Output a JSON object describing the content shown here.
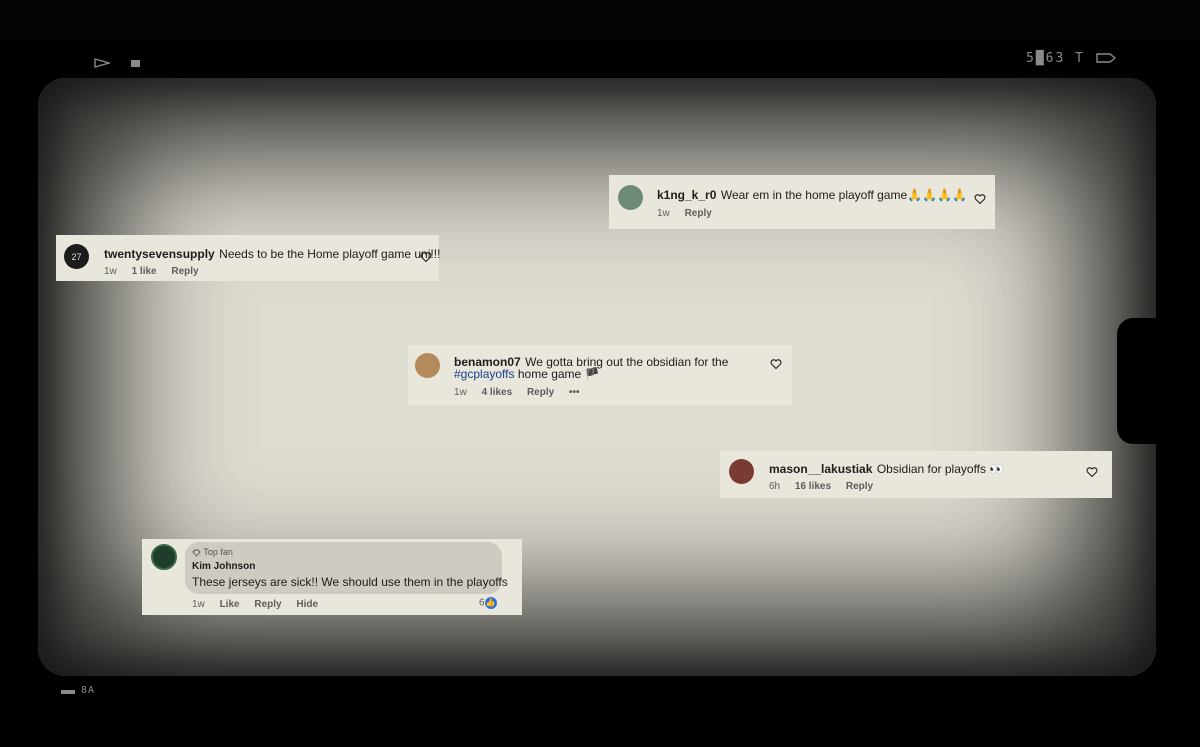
{
  "hud": {
    "top_right": "5█63 T",
    "bottom_left": "8A"
  },
  "comments": [
    {
      "username": "k1ng_k_r0",
      "text": "Wear em in the home playoff game🙏🙏🙏🙏",
      "time": "1w",
      "reply": "Reply"
    },
    {
      "username": "twentysevensupply",
      "text": "Needs to be the Home playoff game uni!!!",
      "time": "1w",
      "likes": "1 like",
      "reply": "Reply",
      "avatar_text": "27"
    },
    {
      "username": "benamon07",
      "text_line1": "We gotta bring out the obsidian for the",
      "hashtag": "#gcplayoffs",
      "text_line2_rest": "home game 🏴",
      "time": "1w",
      "likes": "4 likes",
      "reply": "Reply",
      "more": "•••"
    },
    {
      "username": "mason__lakustiak",
      "text": "Obsidian for playoffs 👀",
      "time": "6h",
      "likes": "16 likes",
      "reply": "Reply"
    }
  ],
  "fb_comment": {
    "badge": "Top fan",
    "name": "Kim Johnson",
    "text": "These jerseys are sick!! We should use them in the playoffs",
    "time": "1w",
    "like": "Like",
    "reply": "Reply",
    "hide": "Hide",
    "reaction_count": "6"
  },
  "icons": [
    "play-icon",
    "stop-icon",
    "heart-icon",
    "like-icon",
    "diamond-icon"
  ],
  "colors": {
    "screen": "#dedbd1",
    "card": "#e9e6dc",
    "hashtag": "#1a3f8c",
    "like_blue": "#2f6fdc"
  }
}
